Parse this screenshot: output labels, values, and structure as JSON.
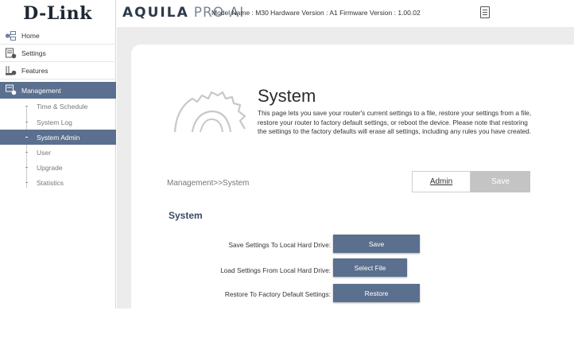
{
  "header": {
    "logo": "D-Link",
    "brand_primary": "AQUILA",
    "brand_secondary": "PRO AI",
    "model_info": "Model Name : M30 Hardware Version : A1 Firmware Version : 1.00.02",
    "doc_icon": "document-icon"
  },
  "sidebar": {
    "items": [
      {
        "label": "Home",
        "icon": "home-icon"
      },
      {
        "label": "Settings",
        "icon": "settings-icon"
      },
      {
        "label": "Features",
        "icon": "features-icon"
      },
      {
        "label": "Management",
        "icon": "management-icon"
      }
    ],
    "sub_items": [
      {
        "label": "Time & Schedule"
      },
      {
        "label": "System Log"
      },
      {
        "label": "System Admin"
      },
      {
        "label": "User"
      },
      {
        "label": "Upgrade"
      },
      {
        "label": "Statistics"
      }
    ],
    "active_color": "#5b6f8e"
  },
  "main": {
    "title": "System",
    "description": "This page lets you save your router's current settings to a file, restore your settings from a file, restore your router to factory default settings, or reboot the device. Please note that restoring the settings to the factory defaults will erase all settings, including any rules you have created.",
    "breadcrumb": "Management>>System",
    "tabs": {
      "admin": "Admin",
      "save": "Save"
    },
    "section_title": "System",
    "rows": [
      {
        "label": "Save Settings To Local Hard Drive:",
        "button": "Save"
      },
      {
        "label": "Load Settings From Local Hard Drive:",
        "button": "Select File"
      },
      {
        "label": "Restore To Factory Default Settings:",
        "button": "Restore"
      }
    ]
  }
}
